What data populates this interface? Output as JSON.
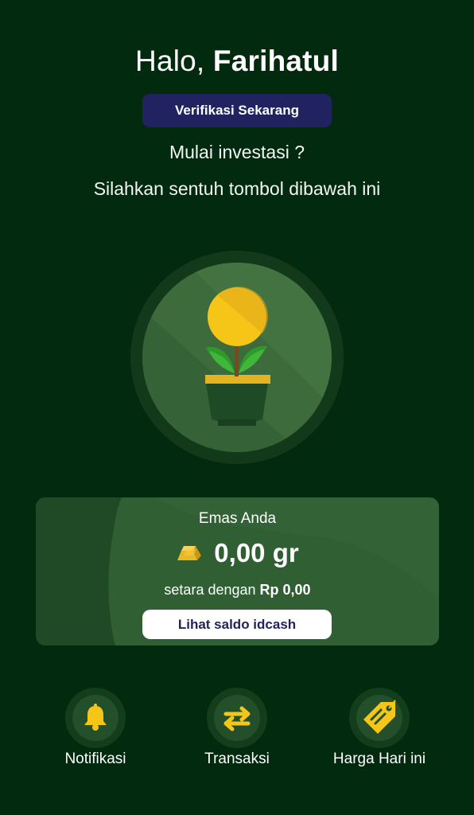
{
  "header": {
    "greeting_prefix": "Halo,",
    "user_name": "Farihatul",
    "verify_button": "Verifikasi Sekarang",
    "subtitle_line1": "Mulai investasi ?",
    "subtitle_line2": "Silahkan sentuh tombol dibawah ini"
  },
  "invest_button": {
    "icon": "plant-coin-icon"
  },
  "gold_card": {
    "label": "Emas Anda",
    "amount": "0,00 gr",
    "equivalent_prefix": "setara dengan",
    "equivalent_value": "Rp 0,00",
    "saldo_button": "Lihat saldo idcash",
    "icon": "gold-bar-icon"
  },
  "bottom_nav": {
    "items": [
      {
        "label": "Notifikasi",
        "icon": "bell-icon"
      },
      {
        "label": "Transaksi",
        "icon": "swap-arrows-icon"
      },
      {
        "label": "Harga Hari ini",
        "icon": "price-tag-icon"
      }
    ]
  },
  "colors": {
    "background": "#022a0e",
    "accent_gold": "#f5c518",
    "verify_button_bg": "#20235f",
    "card_bg": "#1f4a25"
  }
}
